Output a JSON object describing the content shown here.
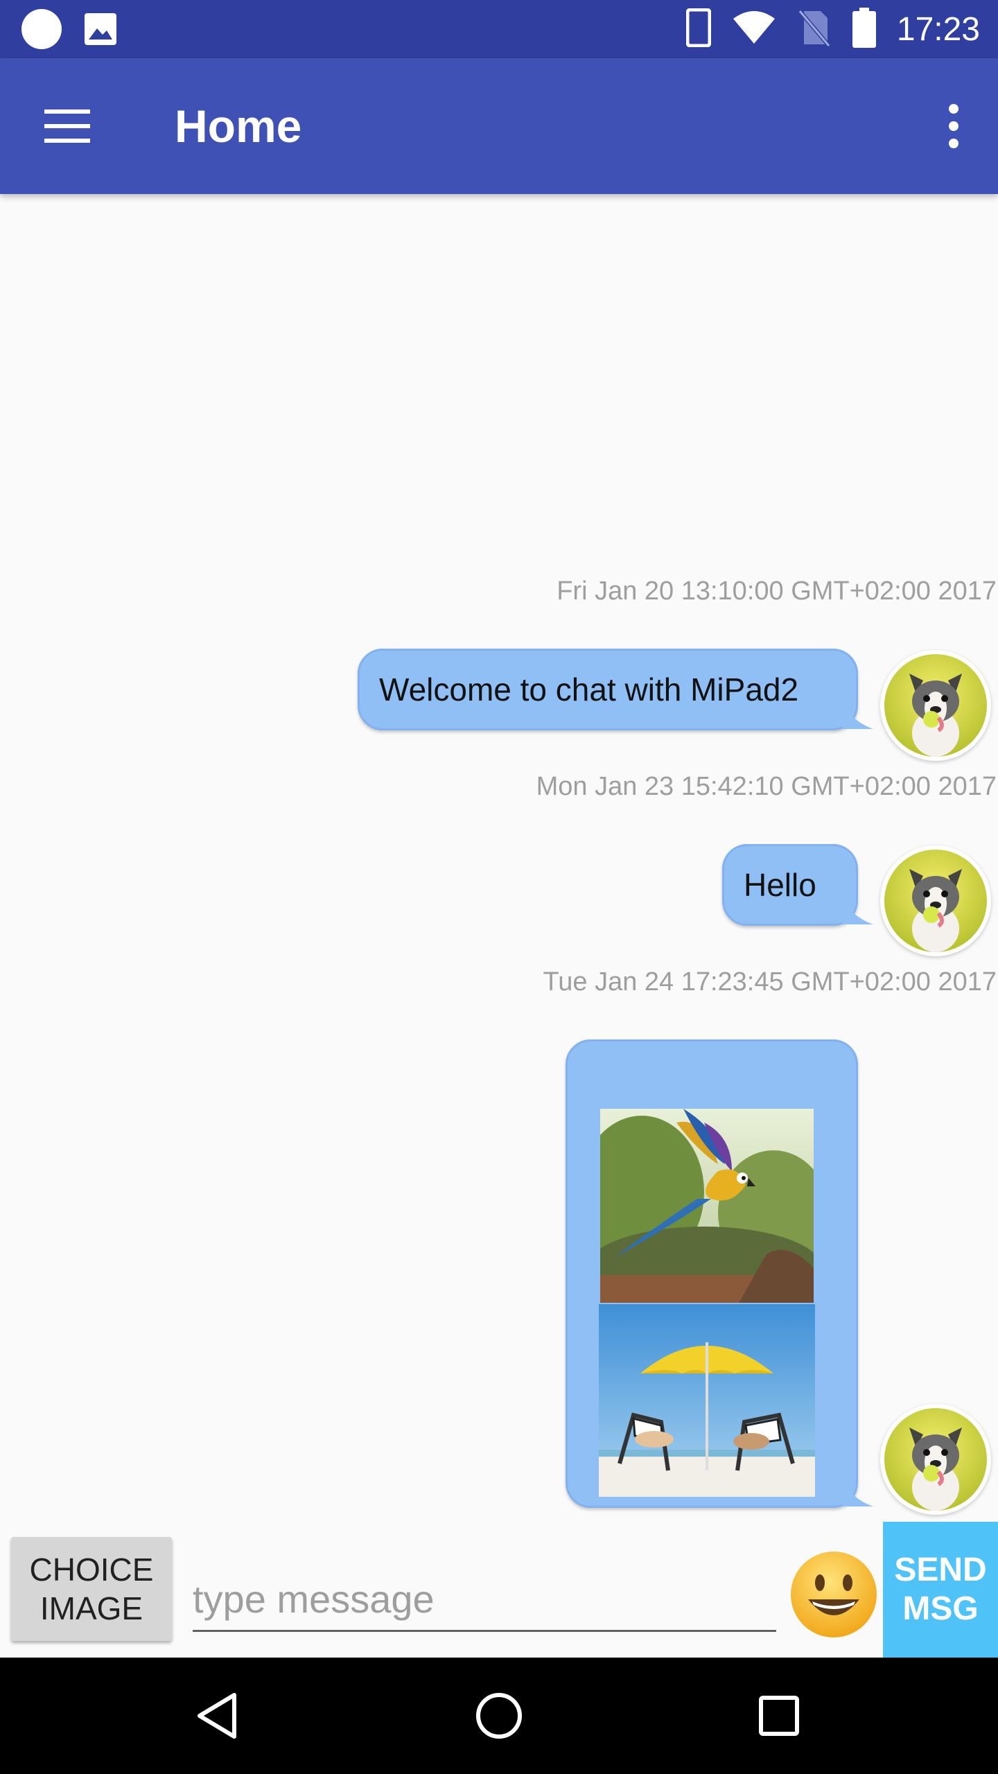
{
  "status_bar": {
    "time": "17:23",
    "left_icons": [
      "circle-notification-icon",
      "image-notification-icon"
    ],
    "right_icons": [
      "phone-icon",
      "wifi-icon",
      "no-sim-icon",
      "battery-icon"
    ]
  },
  "app_bar": {
    "title": "Home",
    "menu_icon": "hamburger-menu-icon",
    "overflow_icon": "more-vert-icon"
  },
  "messages": [
    {
      "timestamp": "Fri Jan 20 13:10:00 GMT+02:00 2017",
      "text": "Welcome to chat with MiPad2",
      "type": "text"
    },
    {
      "timestamp": "Mon Jan 23 15:42:10 GMT+02:00 2017",
      "text": "Hello",
      "type": "text"
    },
    {
      "timestamp": "Tue Jan 24 17:23:45 GMT+02:00 2017",
      "type": "images",
      "images": [
        "parrot-photo",
        "beach-umbrella-photo"
      ]
    }
  ],
  "avatar_icon": "french-bulldog-avatar",
  "input_bar": {
    "choice_image_line1": "CHOICE",
    "choice_image_line2": "IMAGE",
    "message_placeholder": "type message",
    "emoji_icon": "smiley-emoji-icon",
    "send_line1": "SEND",
    "send_line2": "MSG"
  },
  "nav_bar": {
    "buttons": [
      "back-icon",
      "home-icon",
      "recents-icon"
    ]
  },
  "colors": {
    "status_bar": "#303f9f",
    "app_bar": "#3f51b5",
    "bubble": "#90bff5",
    "send_button": "#4fc3f7",
    "choice_button": "#d6d6d6"
  }
}
